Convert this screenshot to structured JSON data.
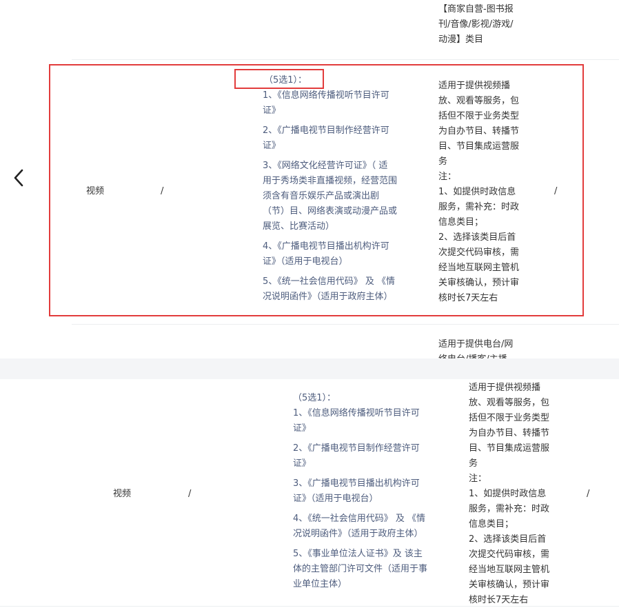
{
  "top_partial": {
    "desc_lines": [
      "【商家自营-图书报",
      "刊/音像/影视/游戏/",
      "动漫】类目"
    ]
  },
  "highlighted_row": {
    "category": "视频",
    "col2": "/",
    "quals": [
      [
        "（5选1）："
      ],
      [
        "1、《信息网络传播视听节目许可",
        "证》"
      ],
      [
        "2、《广播电视节目制作经营许可",
        "证》"
      ],
      [
        "3、《网络文化经营许可证》（ 适",
        "用于秀场类非直播视频，经营范围",
        "须含有音乐娱乐产品或演出剧",
        "（节）目、网络表演或动漫产品或",
        "展览、比赛活动）"
      ],
      [
        "4、《广播电视节目播出机构许可",
        "证》（适用于电视台）"
      ],
      [
        "5、《统一社会信用代码》 及 《情",
        "况说明函件》（适用于政府主体）"
      ]
    ],
    "desc_lines": [
      "适用于提供视频播",
      "放、观看等服务，包",
      "括但不限于业务类型",
      "为自办节目、转播节",
      "目、节目集成运营服",
      "务",
      "注：",
      "1、如提供时政信息",
      "服务，需补充：时政",
      "信息类目；",
      "2、选择该类目后首",
      "次提交代码审核，需",
      "经当地互联网主管机",
      "关审核确认，预计审",
      "核时长7天左右"
    ],
    "last_col": "/"
  },
  "next_partial": {
    "desc_lines": [
      "适用于提供电台/网",
      "络电台/播客/主播"
    ]
  },
  "bottom_row": {
    "category": "视频",
    "col2": "/",
    "quals": [
      [
        "（5选1）："
      ],
      [
        "1、《信息网络传播视听节目许可",
        "证》"
      ],
      [
        "2、《广播电视节目制作经营许可",
        "证》"
      ],
      [
        "3、《广播电视节目播出机构许可",
        "证》（适用于电视台）"
      ],
      [
        "4、《统一社会信用代码》 及 《情",
        "况说明函件》（适用于政府主体）"
      ],
      [
        "5、《事业单位法人证书》及 该主",
        "体的主管部门许可文件（适用于事",
        "业单位主体）"
      ]
    ],
    "desc_lines": [
      "适用于提供视频播",
      "放、观看等服务，包",
      "括但不限于业务类型",
      "为自办节目、转播节",
      "目、节目集成运营服",
      "务",
      "注：",
      "1、如提供时政信息",
      "服务，需补充：时政",
      "信息类目；",
      "2、选择该类目后首",
      "次提交代码审核，需",
      "经当地互联网主管机",
      "关审核确认，预计审",
      "核时长7天左右"
    ],
    "last_col": "/"
  },
  "nav": {
    "prev_icon": "chevron-left-icon"
  }
}
